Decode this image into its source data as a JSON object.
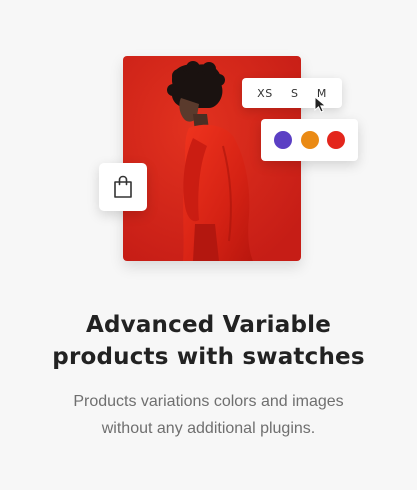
{
  "feature": {
    "title_line1": "Advanced Variable",
    "title_line2": "products with swatches",
    "description_line1": "Products variations colors and images",
    "description_line2": "without any additional plugins."
  },
  "sizes": [
    "XS",
    "S",
    "M"
  ],
  "selected_size": "M",
  "swatches": [
    {
      "name": "purple",
      "color": "#5b3fc4"
    },
    {
      "name": "orange",
      "color": "#ea8a14"
    },
    {
      "name": "red",
      "color": "#e3261c"
    }
  ],
  "colors": {
    "background": "#f7f7f7",
    "photo_red": "#d8251c",
    "title": "#222222",
    "description": "#6f6f6f"
  },
  "icons": {
    "bag": "shopping-bag-icon",
    "cursor": "mouse-pointer-icon"
  }
}
